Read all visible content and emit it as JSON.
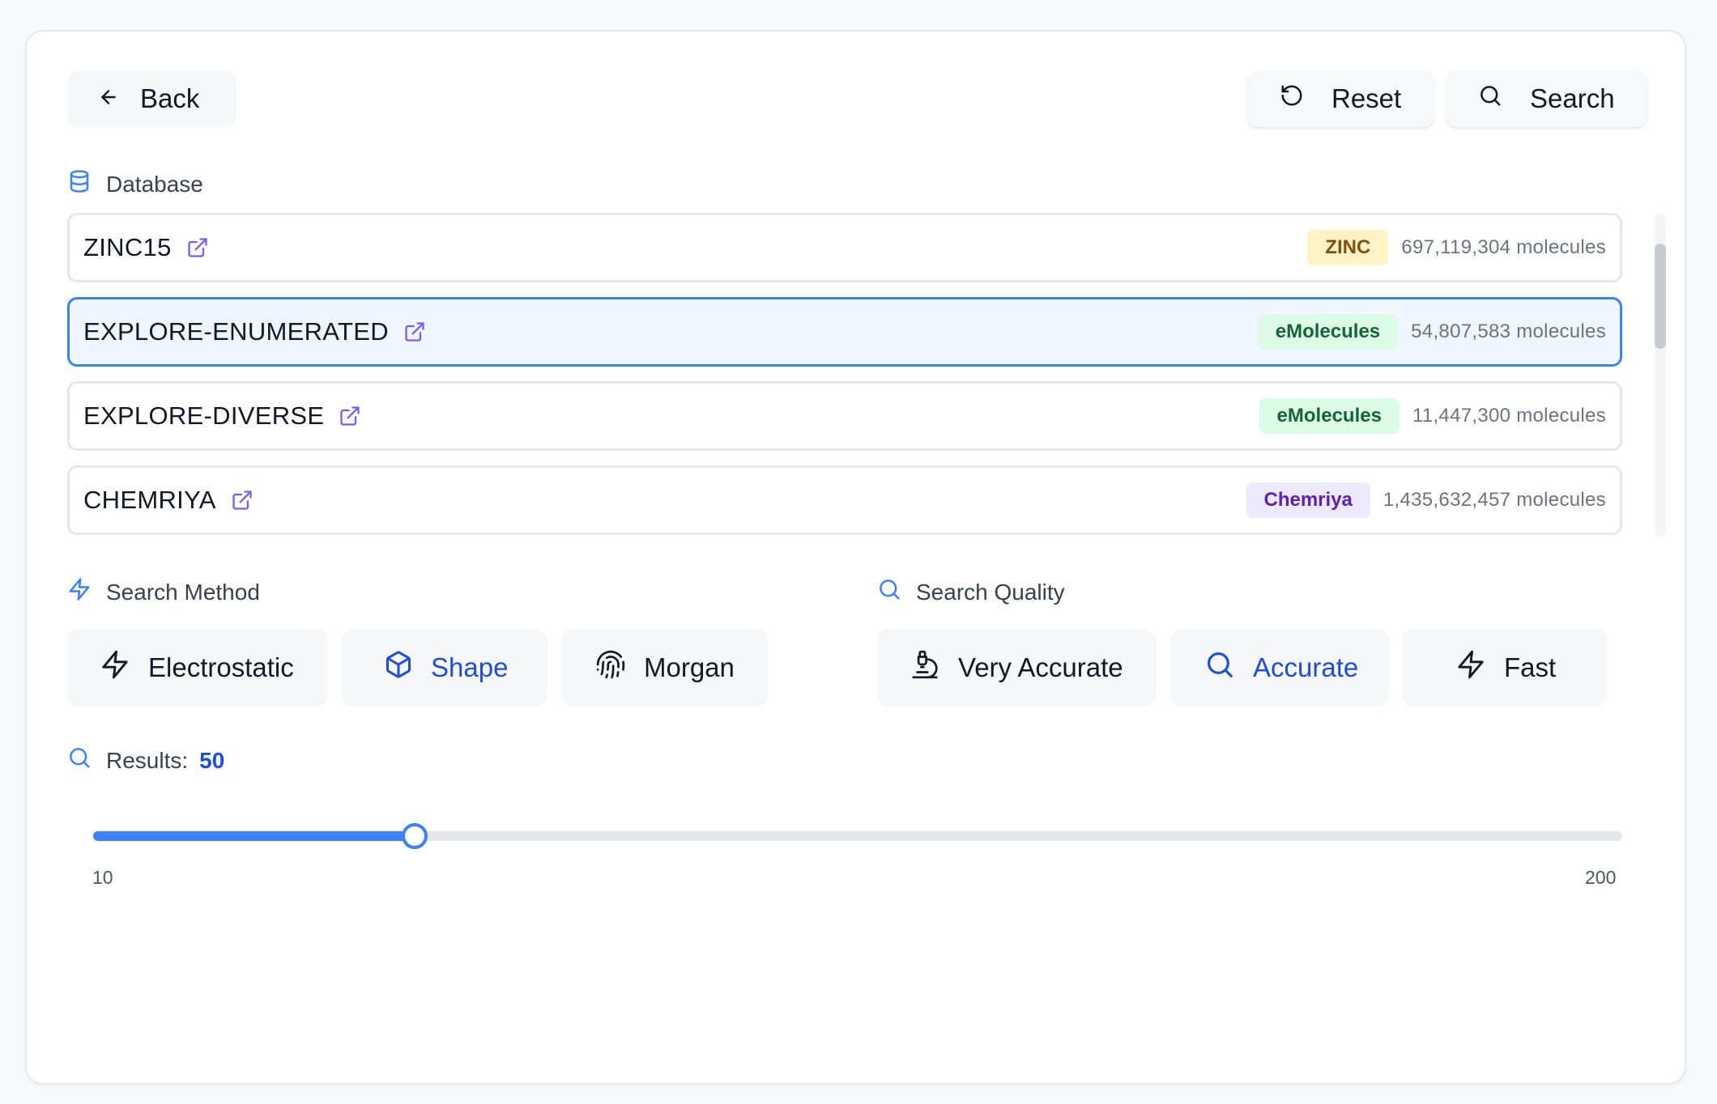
{
  "toolbar": {
    "back_label": "Back",
    "reset_label": "Reset",
    "search_label": "Search"
  },
  "database": {
    "label": "Database",
    "items": [
      {
        "name": "ZINC15",
        "badge": "ZINC",
        "badge_color": "#fdf3c4",
        "count": "697,119,304 molecules",
        "selected": false
      },
      {
        "name": "EXPLORE-ENUMERATED",
        "badge": "eMolecules",
        "badge_color": "#dcfce7",
        "count": "54,807,583 molecules",
        "selected": true
      },
      {
        "name": "EXPLORE-DIVERSE",
        "badge": "eMolecules",
        "badge_color": "#dcfce7",
        "count": "11,447,300 molecules",
        "selected": false
      },
      {
        "name": "CHEMRIYA",
        "badge": "Chemriya",
        "badge_color": "#ede9fe",
        "count": "1,435,632,457 molecules",
        "selected": false
      }
    ]
  },
  "search_method": {
    "label": "Search Method",
    "options": [
      {
        "label": "Electrostatic",
        "icon": "lightning-icon",
        "selected": false
      },
      {
        "label": "Shape",
        "icon": "cube-icon",
        "selected": true
      },
      {
        "label": "Morgan",
        "icon": "fingerprint-icon",
        "selected": false
      }
    ]
  },
  "search_quality": {
    "label": "Search Quality",
    "options": [
      {
        "label": "Very Accurate",
        "icon": "microscope-icon",
        "selected": false
      },
      {
        "label": "Accurate",
        "icon": "search-icon",
        "selected": true
      },
      {
        "label": "Fast",
        "icon": "lightning-icon",
        "selected": false
      }
    ]
  },
  "results": {
    "label": "Results:",
    "value": "50",
    "numeric_value": 50,
    "min": 10,
    "max": 200,
    "min_label": "10",
    "max_label": "200"
  },
  "colors": {
    "accent": "#3b82f6",
    "accent_text": "#1d4ed8",
    "link_icon": "#7c5cf0"
  }
}
